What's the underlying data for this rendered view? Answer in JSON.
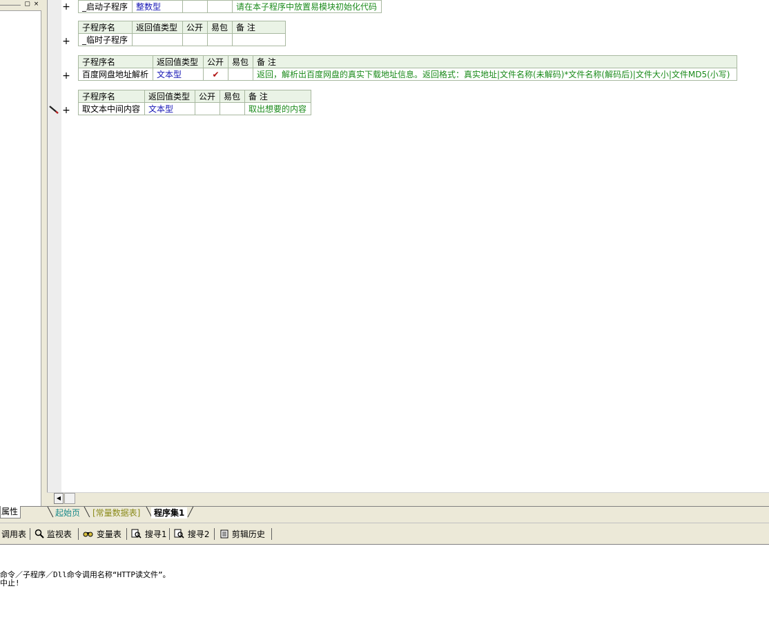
{
  "left_panel": {
    "dock_button": "▢",
    "close_button": "×",
    "properties_tab": "属性"
  },
  "headers": {
    "name": "子程序名",
    "return_type": "返回值类型",
    "public": "公开",
    "easy_pack": "易包",
    "note": "备 注"
  },
  "subroutines": [
    {
      "name": "_启动子程序",
      "return_type": "整数型",
      "public": "",
      "easy_pack": "",
      "note": "请在本子程序中放置易模块初始化代码",
      "show_header": false
    },
    {
      "name": "_临时子程序",
      "return_type": "",
      "public": "",
      "easy_pack": "",
      "note": "",
      "show_header": true
    },
    {
      "name": "百度网盘地址解析",
      "return_type": "文本型",
      "public": "✔",
      "easy_pack": "",
      "note": "返回，解析出百度网盘的真实下载地址信息。返回格式：真实地址|文件名称(未解码)*文件名称(解码后)|文件大小|文件MD5(小写)",
      "show_header": true
    },
    {
      "name": "取文本中间内容",
      "return_type": "文本型",
      "public": "",
      "easy_pack": "",
      "note": "取出想要的内容",
      "show_header": true
    }
  ],
  "expand_symbol": "+",
  "tabs": {
    "start_page": "起始页",
    "constants": "[常量数据表]",
    "program_set": "程序集1"
  },
  "scroll": {
    "left_arrow": "◀"
  },
  "toolbar": {
    "call_table": "调用表",
    "watch_table": "监视表",
    "variable_table": "变量表",
    "search1": "搜寻1",
    "search2": "搜寻2",
    "clip_history": "剪辑历史"
  },
  "output": {
    "line1": "命令／子程序／Dll命令调用名称“HTTP读文件”。",
    "line2": "中止!"
  },
  "colors": {
    "type_blue": "#1515b4",
    "note_green": "#1a8a1a",
    "header_bg": "#eaf3e6",
    "tab_start_teal": "#1a8a8a",
    "tab_const_olive": "#8a8a1a"
  }
}
